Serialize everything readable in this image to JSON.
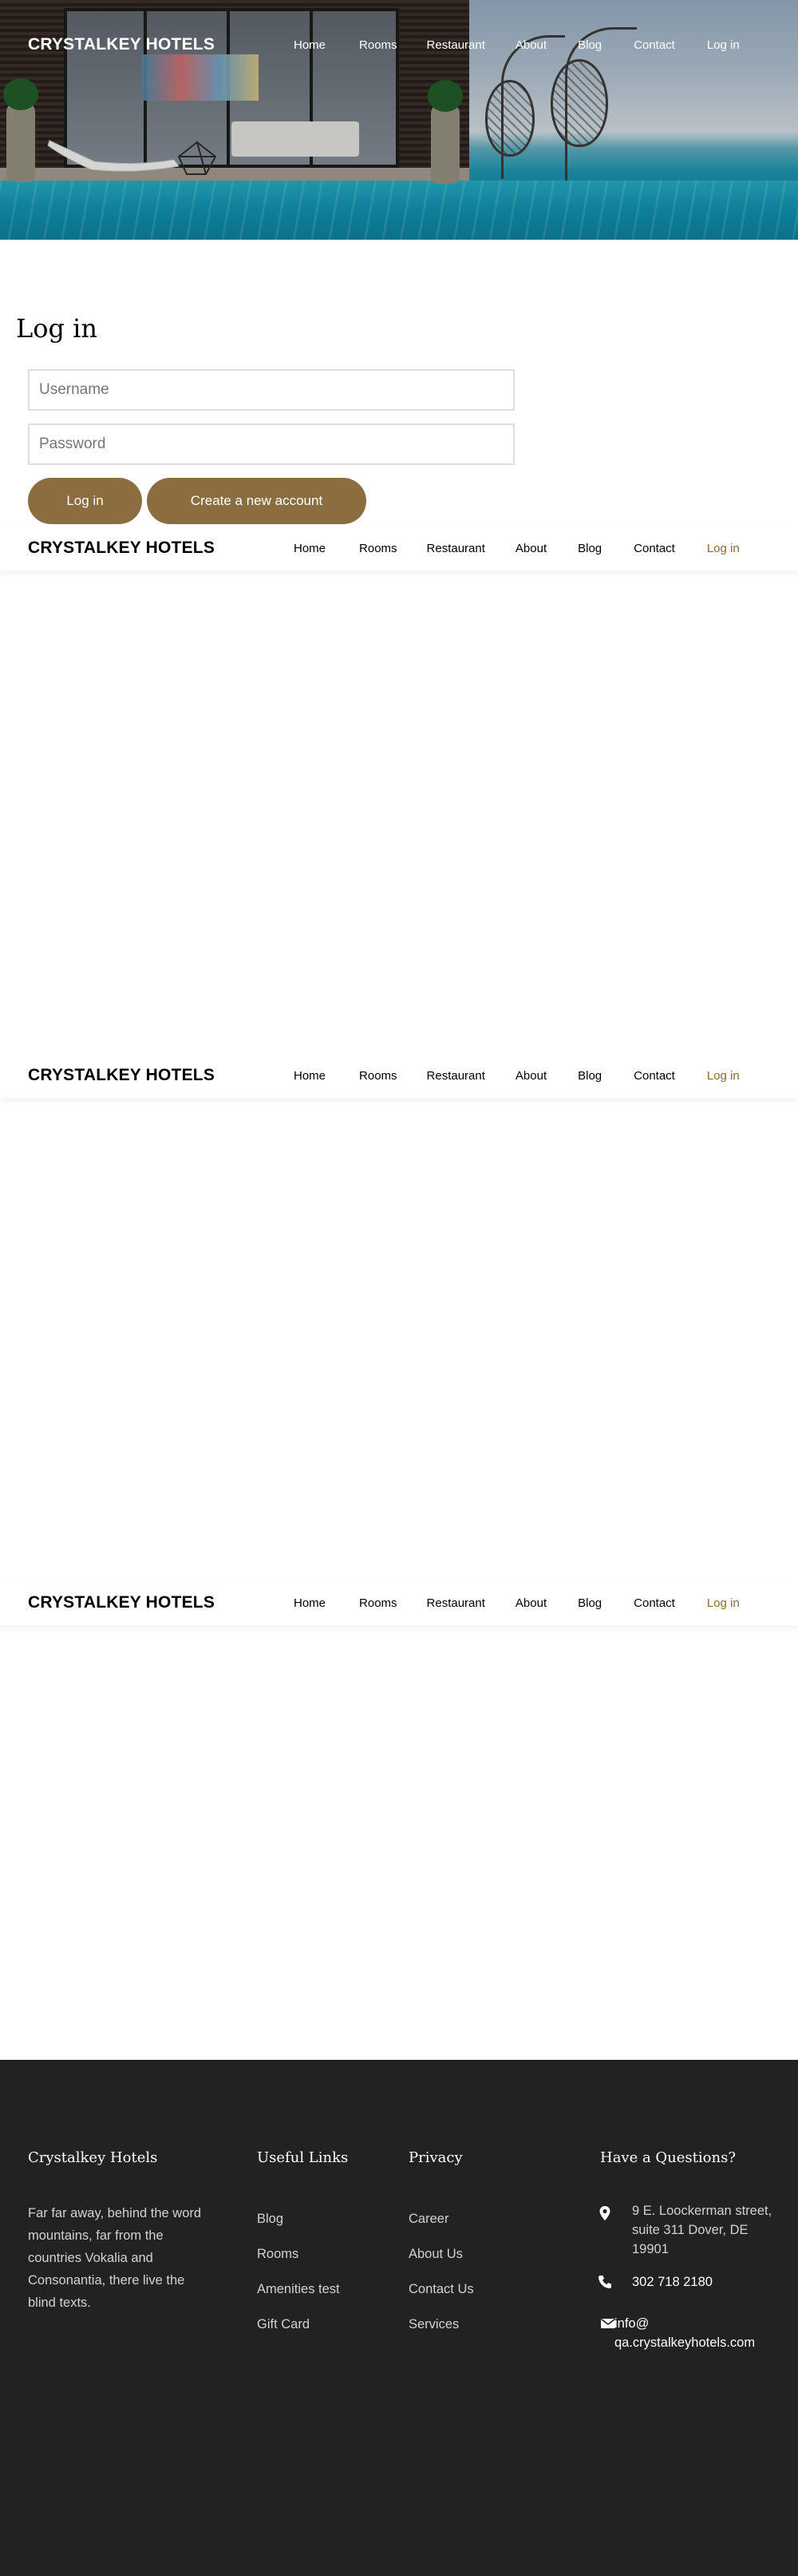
{
  "brand": "CRYSTALKEY HOTELS",
  "nav": {
    "items": [
      "Home",
      "Rooms",
      "Restaurant",
      "About",
      "Blog",
      "Contact",
      "Log in"
    ],
    "active": "Log in"
  },
  "login": {
    "title": "Log in",
    "username_placeholder": "Username",
    "password_placeholder": "Password",
    "login_button": "Log in",
    "create_account_button": "Create a new account"
  },
  "colors": {
    "accent": "#8b6d3f",
    "active_link": "#8c6a2e",
    "footer_bg": "#222222"
  },
  "footer": {
    "about": {
      "heading": "Crystalkey Hotels",
      "text": "Far far away, behind the word mountains, far from the countries Vokalia and Consonantia, there live the blind texts."
    },
    "useful_links": {
      "heading": "Useful Links",
      "items": [
        "Blog",
        "Rooms",
        "Amenities test",
        "Gift Card"
      ]
    },
    "privacy": {
      "heading": "Privacy",
      "items": [
        "Career",
        "About Us",
        "Contact Us",
        "Services"
      ]
    },
    "contact": {
      "heading": "Have a Questions?",
      "address": "9 E. Loockerman street, suite 311 Dover, DE 19901",
      "phone": "302 718 2180",
      "email": "info@ qa.crystalkeyhotels.com"
    }
  }
}
